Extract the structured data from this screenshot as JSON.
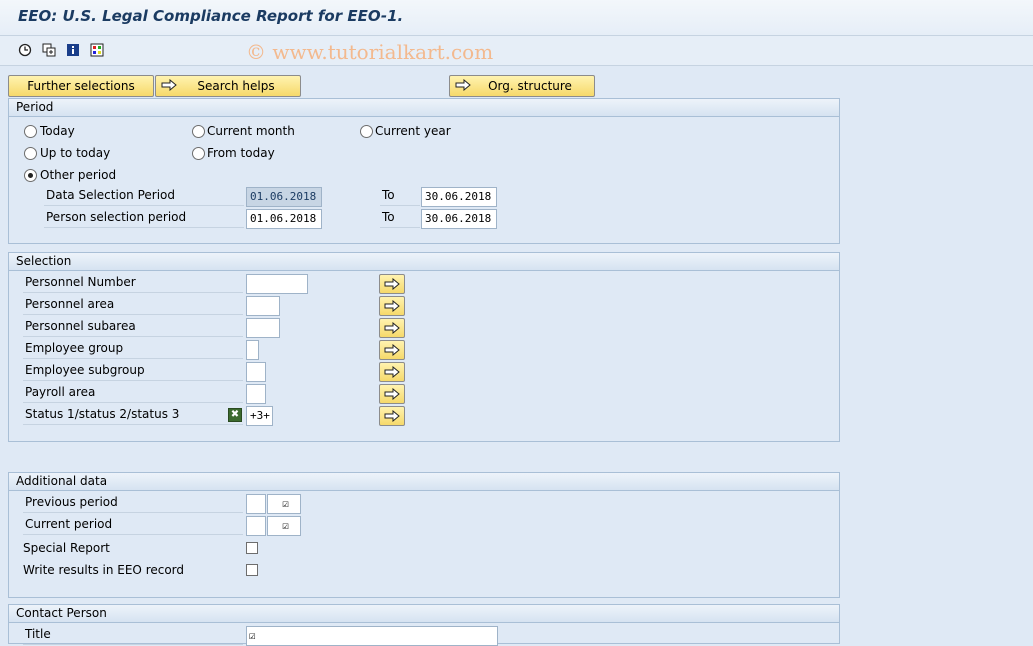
{
  "window": {
    "title": "EEO: U.S. Legal Compliance Report for EEO-1."
  },
  "toolbar": {
    "icons": [
      "execute-icon",
      "copy-icon",
      "info-icon",
      "variant-icon"
    ],
    "watermark": "© www.tutorialkart.com"
  },
  "buttons": {
    "further_selections": "Further selections",
    "search_helps": "Search helps",
    "org_structure": "Org. structure"
  },
  "period": {
    "heading": "Period",
    "radios": {
      "today": "Today",
      "current_month": "Current month",
      "current_year": "Current year",
      "up_to_today": "Up to today",
      "from_today": "From today",
      "other_period": "Other period"
    },
    "selected": "other_period",
    "data_selection": {
      "label": "Data Selection Period",
      "from": "01.06.2018",
      "to_label": "To",
      "to": "30.06.2018"
    },
    "person_selection": {
      "label": "Person selection period",
      "from": "01.06.2018",
      "to_label": "To",
      "to": "30.06.2018"
    }
  },
  "selection": {
    "heading": "Selection",
    "rows": [
      {
        "label": "Personnel Number",
        "value": ""
      },
      {
        "label": "Personnel area",
        "value": ""
      },
      {
        "label": "Personnel subarea",
        "value": ""
      },
      {
        "label": "Employee group",
        "value": ""
      },
      {
        "label": "Employee subgroup",
        "value": ""
      },
      {
        "label": "Payroll area",
        "value": ""
      },
      {
        "label": "Status 1/status 2/status 3",
        "value": "+3+"
      }
    ]
  },
  "additional": {
    "heading": "Additional data",
    "previous_period": {
      "label": "Previous period",
      "checked": true
    },
    "current_period": {
      "label": "Current period",
      "checked": true
    },
    "special_report": {
      "label": "Special Report",
      "checked": false
    },
    "write_results": {
      "label": "Write results in EEO record",
      "checked": false
    }
  },
  "contact": {
    "heading": "Contact Person",
    "title": {
      "label": "Title",
      "checked": true
    }
  },
  "colors": {
    "background": "#dfe9f5",
    "button": "#f6d96a",
    "title": "#1b3b62"
  }
}
